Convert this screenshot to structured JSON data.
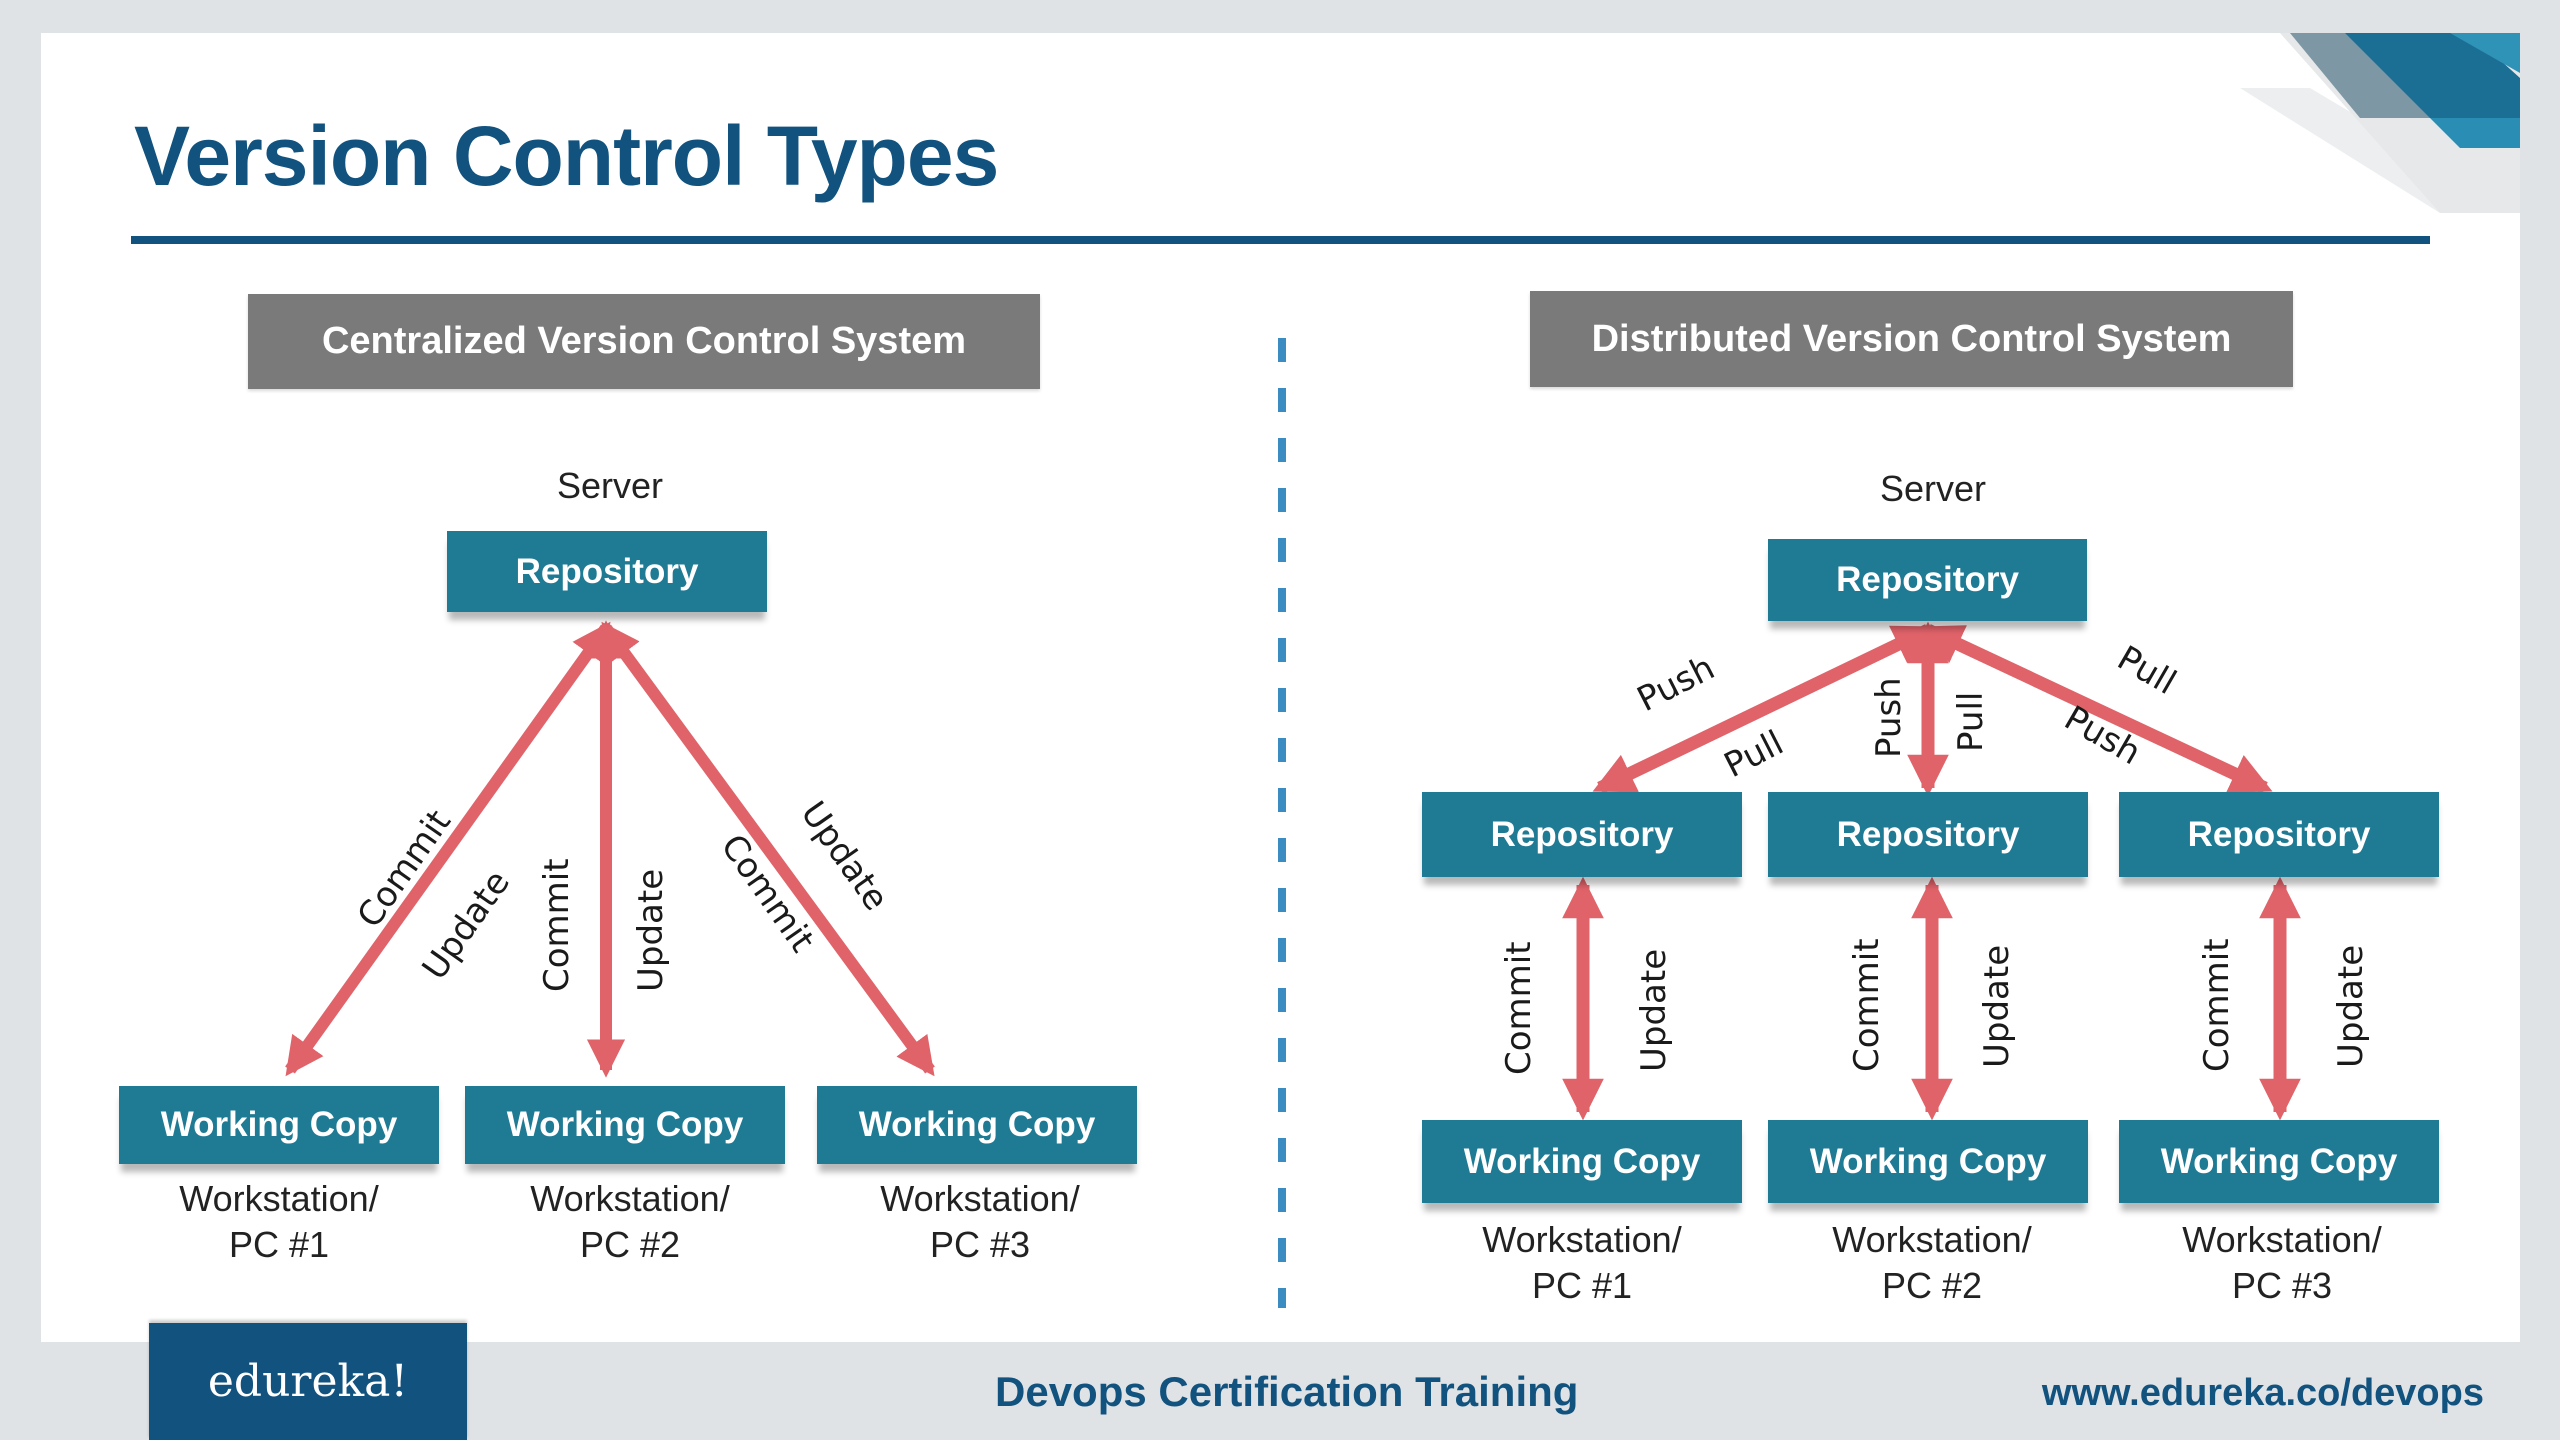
{
  "slide": {
    "title": "Version Control Types",
    "colors": {
      "title_blue": "#11527e",
      "node_teal": "#1f7a94",
      "header_gray": "#7a7a7a",
      "arrow_red": "#e0636a",
      "divider_blue": "#3b8cc0",
      "background": "#dfe3e6"
    }
  },
  "centralized": {
    "header": "Centralized Version Control System",
    "server_label": "Server",
    "server_node": "Repository",
    "working_copies": [
      {
        "node": "Working Copy",
        "line1": "Workstation/",
        "line2": "PC #1",
        "arrow_labels": [
          "Commit",
          "Update"
        ]
      },
      {
        "node": "Working Copy",
        "line1": "Workstation/",
        "line2": "PC #2",
        "arrow_labels": [
          "Commit",
          "Update"
        ]
      },
      {
        "node": "Working Copy",
        "line1": "Workstation/",
        "line2": "PC #3",
        "arrow_labels": [
          "Commit",
          "Update"
        ]
      }
    ]
  },
  "distributed": {
    "header": "Distributed Version Control System",
    "server_label": "Server",
    "server_node": "Repository",
    "clients": [
      {
        "repo": "Repository",
        "sync_labels": [
          "Push",
          "Pull"
        ],
        "working_copy": "Working Copy",
        "local_labels": [
          "Commit",
          "Update"
        ],
        "line1": "Workstation/",
        "line2": "PC #1"
      },
      {
        "repo": "Repository",
        "sync_labels": [
          "Push",
          "Pull"
        ],
        "working_copy": "Working Copy",
        "local_labels": [
          "Commit",
          "Update"
        ],
        "line1": "Workstation/",
        "line2": "PC #2"
      },
      {
        "repo": "Repository",
        "sync_labels": [
          "Pull",
          "Push"
        ],
        "working_copy": "Working Copy",
        "local_labels": [
          "Commit",
          "Update"
        ],
        "line1": "Workstation/",
        "line2": "PC #3"
      }
    ]
  },
  "footer": {
    "logo": "edureka!",
    "course": "Devops Certification Training",
    "url": "www.edureka.co/devops"
  }
}
